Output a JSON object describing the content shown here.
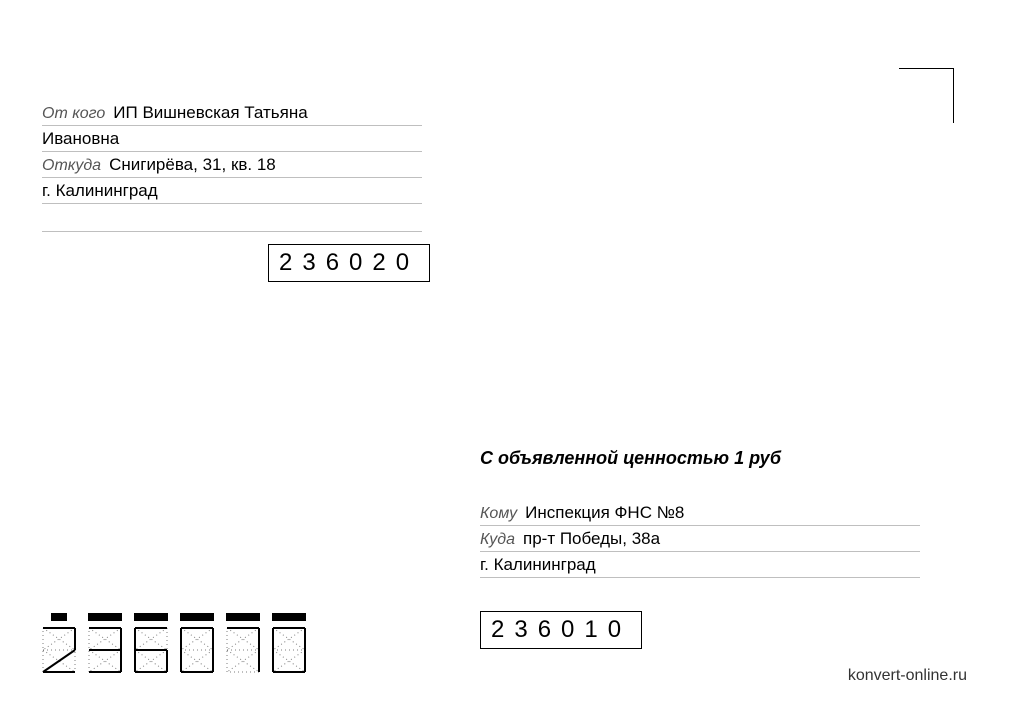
{
  "sender": {
    "label_from": "От кого",
    "name_line1": "ИП Вишневская Татьяна",
    "name_line2": "Ивановна",
    "label_addr": "Откуда",
    "addr_line1": "Снигирёва, 31, кв. 18",
    "addr_line2": "г. Калининград",
    "index": "236020"
  },
  "declared_value": "С объявленной ценностью 1 руб",
  "recipient": {
    "label_to": "Кому",
    "name": "Инспекция ФНС №8",
    "label_addr": "Куда",
    "addr_line1": "пр-т Победы, 38а",
    "addr_line2": "г. Калининград",
    "index": "236010"
  },
  "dotted_index": "236010",
  "site": "konvert-online.ru"
}
